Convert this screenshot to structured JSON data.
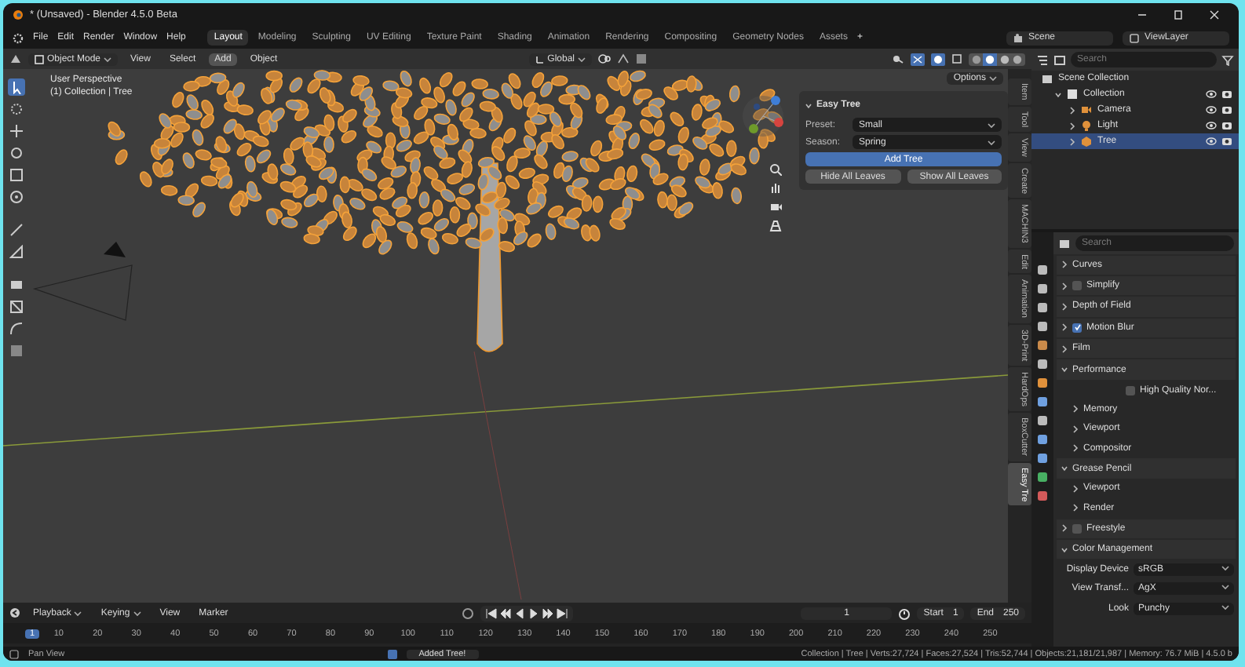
{
  "window": {
    "title": "* (Unsaved) - Blender 4.5.0 Beta"
  },
  "menu": [
    "File",
    "Edit",
    "Render",
    "Window",
    "Help"
  ],
  "workspaces": [
    {
      "label": "Layout",
      "selected": true
    },
    {
      "label": "Modeling",
      "selected": false
    },
    {
      "label": "Sculpting",
      "selected": false
    },
    {
      "label": "UV Editing",
      "selected": false
    },
    {
      "label": "Texture Paint",
      "selected": false
    },
    {
      "label": "Shading",
      "selected": false
    },
    {
      "label": "Animation",
      "selected": false
    },
    {
      "label": "Rendering",
      "selected": false
    },
    {
      "label": "Compositing",
      "selected": false
    },
    {
      "label": "Geometry Nodes",
      "selected": false
    },
    {
      "label": "Assets",
      "selected": false
    }
  ],
  "add_workspace": "+",
  "scene": {
    "name": "Scene"
  },
  "view_layer": {
    "name": "ViewLayer"
  },
  "viewport": {
    "mode": "Object Mode",
    "menus": [
      {
        "label": "View",
        "hovered": false
      },
      {
        "label": "Select",
        "hovered": false
      },
      {
        "label": "Add",
        "hovered": true
      },
      {
        "label": "Object",
        "hovered": false
      }
    ],
    "orientation": "Global",
    "options": "Options",
    "overlay_text": [
      "User Perspective",
      "(1) Collection | Tree"
    ]
  },
  "n_panel": {
    "title": "Easy Tree",
    "expanded": true,
    "fields": [
      {
        "label": "Preset:",
        "value": "Small"
      },
      {
        "label": "Season:",
        "value": "Spring"
      }
    ],
    "primary_button": "Add Tree",
    "buttons": [
      "Hide All Leaves",
      "Show All Leaves"
    ]
  },
  "side_tabs": [
    {
      "label": "Item",
      "selected": false
    },
    {
      "label": "Tool",
      "selected": false
    },
    {
      "label": "View",
      "selected": false
    },
    {
      "label": "Create",
      "selected": false
    },
    {
      "label": "MACHIN3",
      "selected": false
    },
    {
      "label": "Edit",
      "selected": false
    },
    {
      "label": "Animation",
      "selected": false
    },
    {
      "label": "3D-Print",
      "selected": false
    },
    {
      "label": "HardOps",
      "selected": false
    },
    {
      "label": "BoxCutter",
      "selected": false
    },
    {
      "label": "Easy Tre",
      "selected": true
    }
  ],
  "outliner": {
    "search_placeholder": "Search",
    "root": "Scene Collection",
    "items": [
      {
        "label": "Collection",
        "kind": "collection",
        "expanded": true,
        "selected": false,
        "children": [
          {
            "label": "Camera",
            "kind": "camera",
            "expanded": false,
            "selected": false
          },
          {
            "label": "Light",
            "kind": "light",
            "expanded": false,
            "selected": false
          },
          {
            "label": "Tree",
            "kind": "mesh",
            "expanded": false,
            "selected": true
          }
        ]
      }
    ]
  },
  "properties": {
    "search_placeholder": "Search",
    "rows": [
      {
        "kind": "section",
        "label": "Curves",
        "expanded": false
      },
      {
        "kind": "section",
        "label": "Simplify",
        "expanded": false,
        "checked": false
      },
      {
        "kind": "section",
        "label": "Depth of Field",
        "expanded": false
      },
      {
        "kind": "section",
        "label": "Motion Blur",
        "expanded": false,
        "checked": true
      },
      {
        "kind": "section",
        "label": "Film",
        "expanded": false
      },
      {
        "kind": "section",
        "label": "Performance",
        "expanded": true
      },
      {
        "kind": "checkbox",
        "label": "High Quality Nor...",
        "checked": false
      },
      {
        "kind": "subsection",
        "label": "Memory",
        "expanded": false
      },
      {
        "kind": "subsection",
        "label": "Viewport",
        "expanded": false
      },
      {
        "kind": "subsection",
        "label": "Compositor",
        "expanded": false
      },
      {
        "kind": "section",
        "label": "Grease Pencil",
        "expanded": true
      },
      {
        "kind": "subsection",
        "label": "Viewport",
        "expanded": false
      },
      {
        "kind": "subsection",
        "label": "Render",
        "expanded": false
      },
      {
        "kind": "section",
        "label": "Freestyle",
        "expanded": false,
        "checked": false
      },
      {
        "kind": "section",
        "label": "Color Management",
        "expanded": true
      },
      {
        "kind": "field",
        "label": "Display Device",
        "value": "sRGB"
      },
      {
        "kind": "field",
        "label": "View Transf...",
        "value": "AgX"
      },
      {
        "kind": "field",
        "label": "Look",
        "value": "Punchy"
      }
    ]
  },
  "timeline": {
    "menus": [
      "Playback",
      "Keying",
      "View",
      "Marker"
    ],
    "current_frame": "1",
    "start_label": "Start",
    "start": "1",
    "end_label": "End",
    "end": "250",
    "ticks": [
      "1",
      "10",
      "20",
      "30",
      "40",
      "50",
      "60",
      "70",
      "80",
      "90",
      "100",
      "110",
      "120",
      "130",
      "140",
      "150",
      "160",
      "170",
      "180",
      "190",
      "200",
      "210",
      "220",
      "230",
      "240",
      "250"
    ]
  },
  "status_bar": {
    "hint": "Pan View",
    "message": "Added Tree!",
    "stats": "Collection | Tree | Verts:27,724 | Faces:27,524 | Tris:52,744 | Objects:21,181/21,987 | Memory: 76.7 MiB | 4.5.0 b"
  }
}
